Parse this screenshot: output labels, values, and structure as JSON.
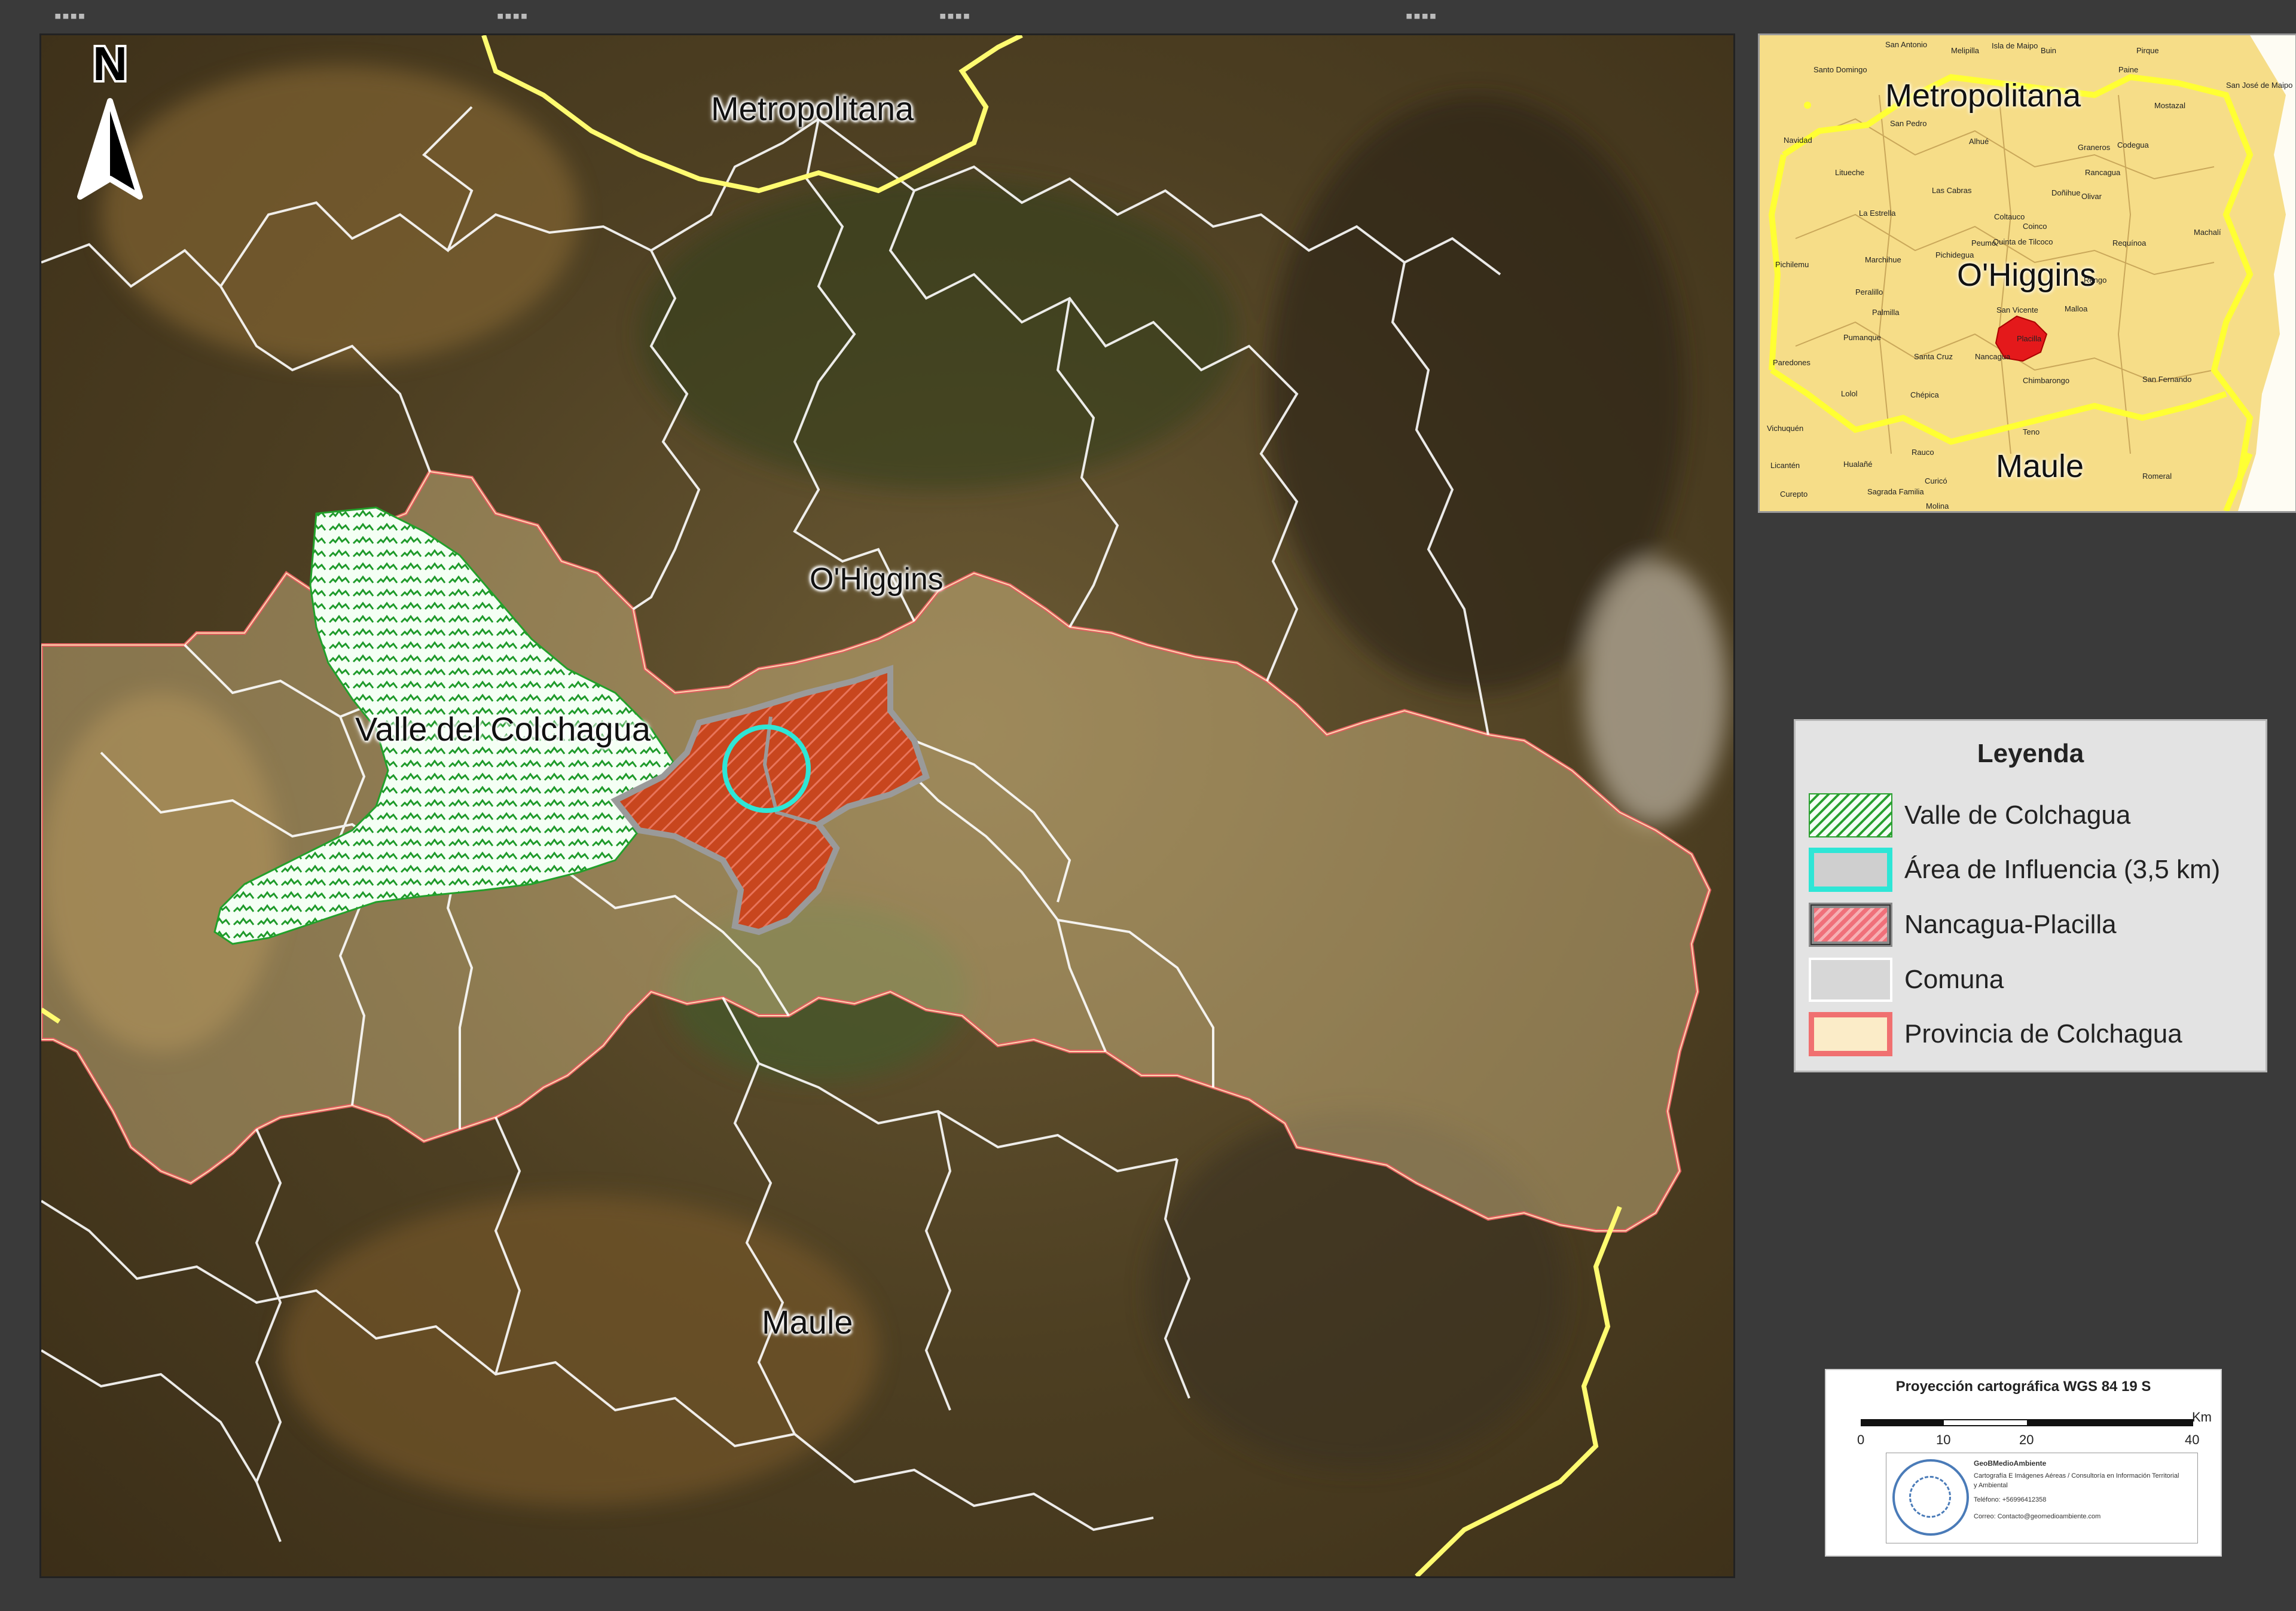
{
  "map": {
    "labels": {
      "metropolitana": "Metropolitana",
      "ohiggins": "O'Higgins",
      "valle": "Valle del Colchagua",
      "maule": "Maule"
    },
    "north_letter": "N",
    "colors": {
      "province": "#e06060",
      "region": "#ffff66",
      "comuna": "#ffffff",
      "influence": "#2ee6d6",
      "nancagua": "#c0401a",
      "valle": "#22a02a"
    }
  },
  "inset": {
    "regions": {
      "metropolitana": "Metropolitana",
      "ohiggins": "O'Higgins",
      "maule": "Maule"
    },
    "towns": [
      "San Antonio",
      "Melipilla",
      "Isla de Maipo",
      "Buin",
      "Pirque",
      "Paine",
      "San José de Maipo",
      "Santo Domingo",
      "Mostazal",
      "San Pedro",
      "Navidad",
      "Alhué",
      "Graneros",
      "Codegua",
      "Litueche",
      "Rancagua",
      "Las Cabras",
      "Doñihue",
      "Olivar",
      "La Estrella",
      "Coltauco",
      "Coinco",
      "Machalí",
      "Quinta de Tilcoco",
      "Requínoa",
      "Pichidegua",
      "Peumo",
      "Pichilemu",
      "Marchihue",
      "Rengo",
      "Peralillo",
      "Malloa",
      "Palmilla",
      "San Vicente",
      "Pumanque",
      "Placilla",
      "Santa Cruz",
      "Nancagua",
      "Paredones",
      "Chimbarongo",
      "San Fernando",
      "Lolol",
      "Chépica",
      "Vichuquén",
      "Teno",
      "Licantén",
      "Hualañé",
      "Rauco",
      "Curepto",
      "Sagrada Familia",
      "Curicó",
      "Romeral",
      "Molina"
    ]
  },
  "legend": {
    "title": "Leyenda",
    "items": [
      {
        "label": "Valle de Colchagua"
      },
      {
        "label": "Área de Influencia (3,5 km)"
      },
      {
        "label": "Nancagua-Placilla"
      },
      {
        "label": "Comuna"
      },
      {
        "label": "Provincia de Colchagua"
      }
    ]
  },
  "scale": {
    "projection": "Proyección cartográfica WGS 84 19 S",
    "unit": "Km",
    "ticks": [
      "0",
      "10",
      "20",
      "40"
    ]
  },
  "credit": {
    "name": "GeoBMedioAmbiente",
    "line1": "Cartografía E Imágenes Aéreas / Consultoría en Información Territorial",
    "line2": "y Ambiental",
    "phone": "Teléfono: +56996412358",
    "email": "Correo: Contacto@geomedioambiente.com"
  }
}
